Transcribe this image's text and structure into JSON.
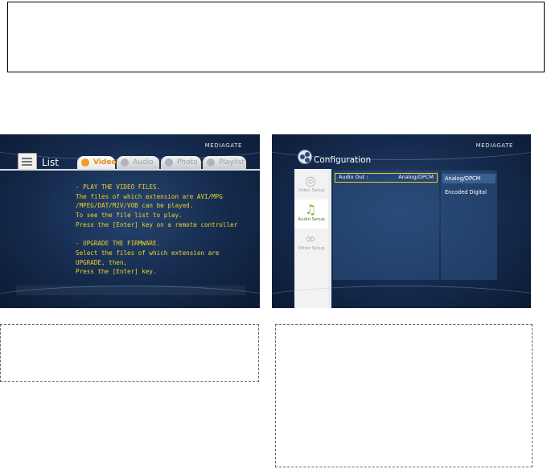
{
  "left_screen": {
    "brand": "MEDIAGATE",
    "title": "List",
    "tabs": [
      {
        "label": "Video",
        "active": true
      },
      {
        "label": "Audio",
        "active": false
      },
      {
        "label": "Photo",
        "active": false
      },
      {
        "label": "Playlist",
        "active": false
      }
    ],
    "info_text": "- PLAY THE VIDEO FILES.\nThe files of which extension are AVI/MPG\n/MPEG/DAT/M2V/VOB can be played.\nTo see the file list to play.\nPress the [Enter] key on a remote controller\n\n- UPGRADE THE FIRMWARE.\nSelect the files of which extension are\nUPGRADE, then,\nPress the [Enter] key."
  },
  "right_screen": {
    "brand": "MEDIAGATE",
    "title": "Configuration",
    "side_items": [
      {
        "label": "Video Setup",
        "icon": "disc-icon",
        "active": false
      },
      {
        "label": "Audio Setup",
        "icon": "music-note-icon",
        "active": true
      },
      {
        "label": "Other Setup",
        "icon": "link-icon",
        "active": false
      }
    ],
    "setting": {
      "label": "Audio Out :",
      "value": "Analog/DPCM"
    },
    "options": [
      "Analog/DPCM",
      "Encoded Digital"
    ]
  },
  "colors": {
    "info_text": "#f0d22c",
    "selection_border": "#e6cf2c",
    "active_tab_text": "#e38b16"
  }
}
